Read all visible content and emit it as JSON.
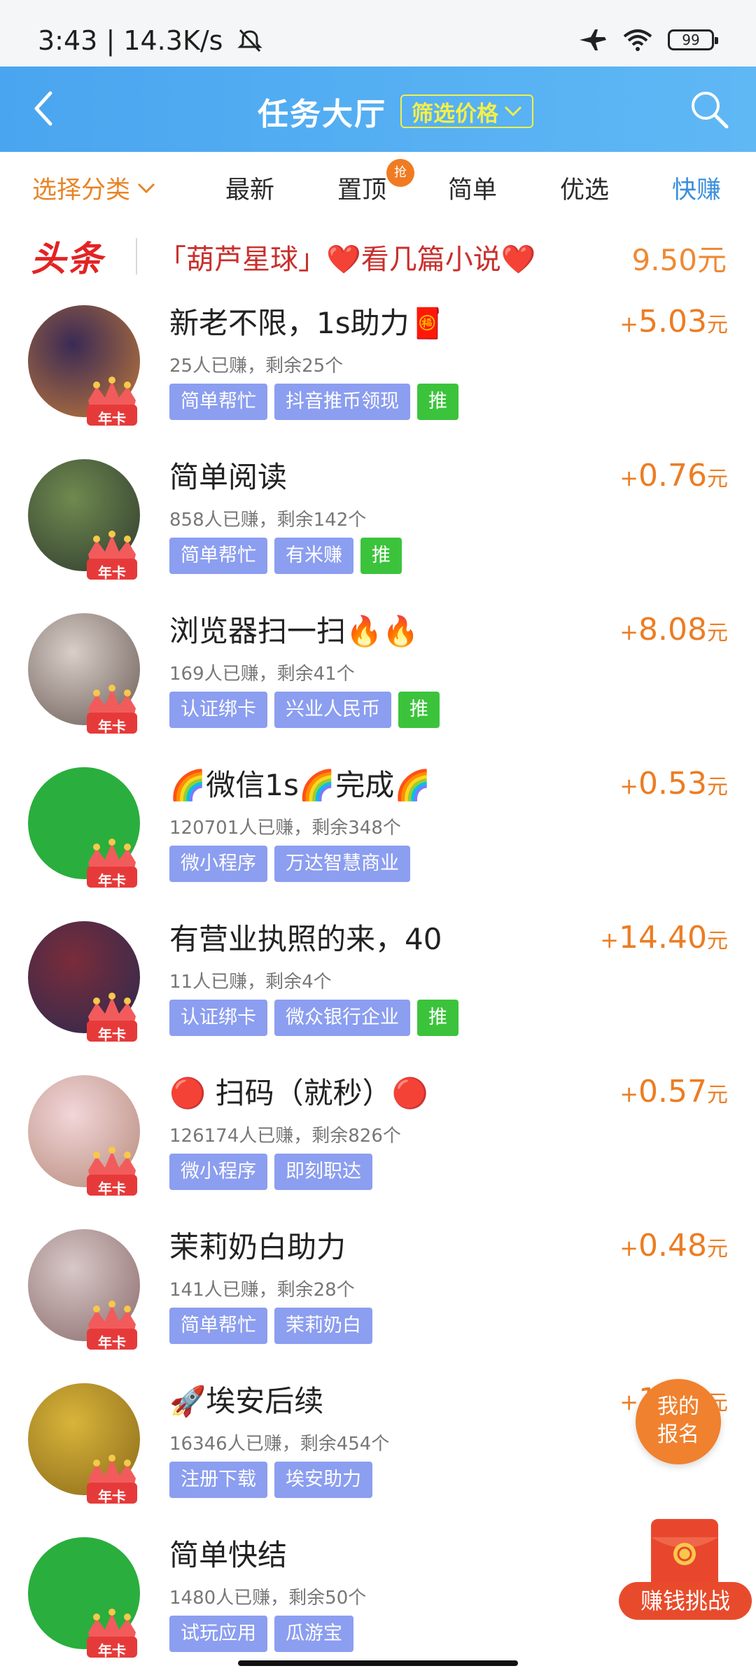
{
  "status_bar": {
    "time": "3:43",
    "speed": "14.3K/s",
    "battery": "99"
  },
  "header": {
    "title": "任务大厅",
    "filter_label": "筛选价格"
  },
  "tabs": {
    "category": "选择分类",
    "latest": "最新",
    "pinned": "置顶",
    "pinned_badge": "抢",
    "simple": "简单",
    "featured": "优选",
    "quick": "快赚"
  },
  "headline": {
    "tag": "头条",
    "text": "「葫芦星球」❤️看几篇小说❤️",
    "price": "9.50元"
  },
  "badge_label": "年卡",
  "tasks": [
    {
      "title": "新老不限，1s助力🧧",
      "stats": "25人已赚，剩余25个",
      "tags": [
        "简单帮忙",
        "抖音推币领现"
      ],
      "push": "推",
      "reward": "5.03",
      "avatar_colors": [
        "#3a2a55",
        "#c27a3a"
      ]
    },
    {
      "title": "简单阅读",
      "stats": "858人已赚，剩余142个",
      "tags": [
        "简单帮忙",
        "有米赚"
      ],
      "push": "推",
      "reward": "0.76",
      "avatar_colors": [
        "#6f8a4f",
        "#2f3a2f"
      ]
    },
    {
      "title": "浏览器扫一扫🔥🔥",
      "stats": "169人已赚，剩余41个",
      "tags": [
        "认证绑卡",
        "兴业人民币"
      ],
      "push": "推",
      "reward": "8.08",
      "avatar_colors": [
        "#d9cfc8",
        "#6a5a55"
      ]
    },
    {
      "title": "🌈微信1s🌈完成🌈",
      "stats": "120701人已赚，剩余348个",
      "tags": [
        "微小程序",
        "万达智慧商业"
      ],
      "push": "",
      "reward": "0.53",
      "avatar_colors": [
        "#2aae3e",
        "#2aae3e"
      ]
    },
    {
      "title": "有营业执照的来，40",
      "stats": "11人已赚，剩余4个",
      "tags": [
        "认证绑卡",
        "微众银行企业"
      ],
      "push": "推",
      "reward": "14.40",
      "avatar_colors": [
        "#7a2c3a",
        "#2c2a50"
      ]
    },
    {
      "title": "🔴 扫码（就秒）🔴",
      "stats": "126174人已赚，剩余826个",
      "tags": [
        "微小程序",
        "即刻职达"
      ],
      "push": "",
      "reward": "0.57",
      "avatar_colors": [
        "#f2d6d9",
        "#b68a7a"
      ]
    },
    {
      "title": "茉莉奶白助力",
      "stats": "141人已赚，剩余28个",
      "tags": [
        "简单帮忙",
        "茉莉奶白"
      ],
      "push": "",
      "reward": "0.48",
      "avatar_colors": [
        "#d8c8c8",
        "#8a6a6a"
      ]
    },
    {
      "title": "🚀埃安后续",
      "stats": "16346人已赚，剩余454个",
      "tags": [
        "注册下载",
        "埃安助力"
      ],
      "push": "",
      "reward": "1.14",
      "avatar_colors": [
        "#d9b43a",
        "#8a6a1a"
      ]
    },
    {
      "title": "简单快结",
      "stats": "1480人已赚，剩余50个",
      "tags": [
        "试玩应用",
        "瓜游宝"
      ],
      "push": "",
      "reward": "",
      "avatar_colors": [
        "#2aae3e",
        "#2aae3e"
      ]
    }
  ],
  "reward_plus": "+",
  "reward_unit": "元",
  "float_signup": "我的\n报名",
  "float_challenge": "赚钱挑战",
  "colors": {
    "header_blue": "#4aa5f0",
    "accent_orange": "#ec7d23",
    "tag_blue": "#8c9ef0",
    "push_green": "#3cc33c",
    "filter_yellow": "#f4ef4a"
  }
}
